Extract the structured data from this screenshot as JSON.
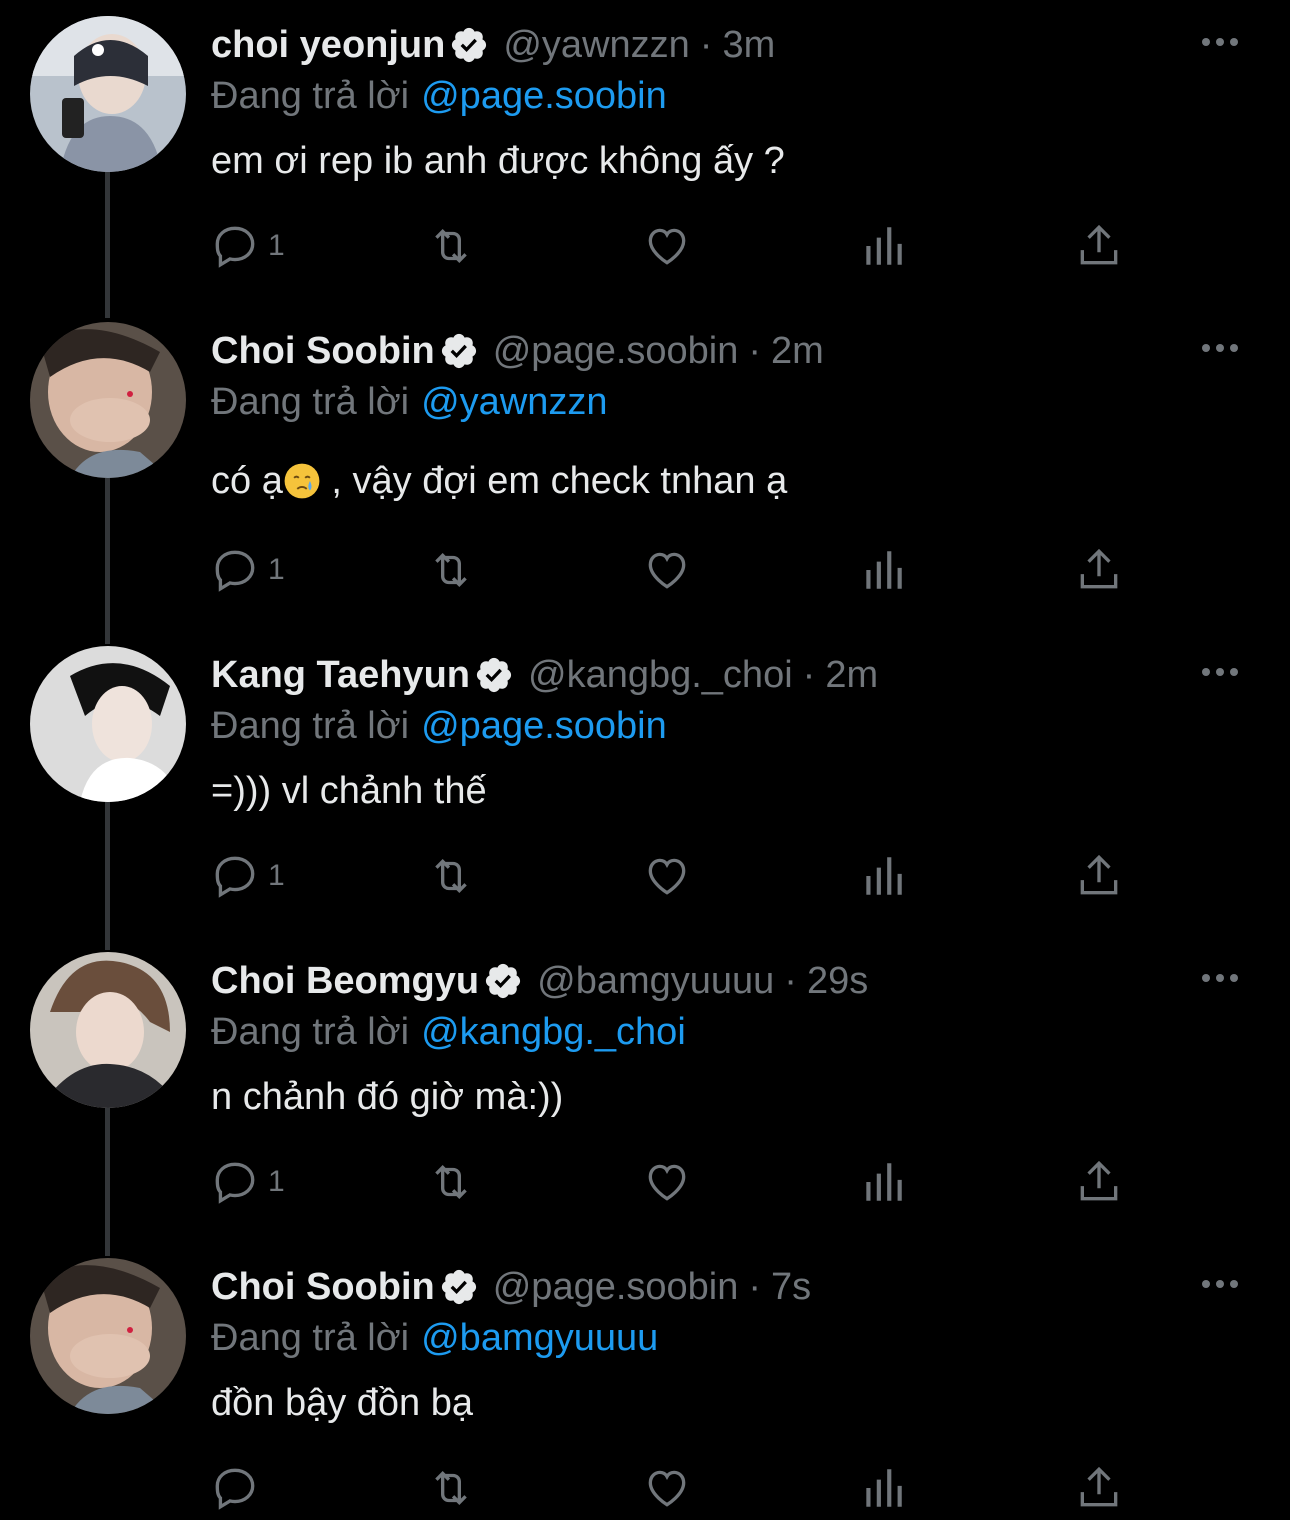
{
  "tweets": [
    {
      "name": "choi yeonjun",
      "handle": "@yawnzzn",
      "dot": "·",
      "time": "3m",
      "reply_prefix": "Đang trả lời",
      "reply_to": "@page.soobin",
      "text": "em ơi rep ib anh được không ấy ?",
      "reply_count": "1"
    },
    {
      "name": "Choi Soobin",
      "handle": "@page.soobin",
      "dot": "·",
      "time": "2m",
      "reply_prefix": "Đang trả lời",
      "reply_to": "@yawnzzn",
      "text_before": "có ạ",
      "emoji": "crying-face-emoji",
      "text_after": " , vậy đợi em check tnhan ạ",
      "reply_count": "1"
    },
    {
      "name": "Kang Taehyun",
      "handle": "@kangbg._choi",
      "dot": "·",
      "time": "2m",
      "reply_prefix": "Đang trả lời",
      "reply_to": "@page.soobin",
      "text": "=))) vl chảnh thế",
      "reply_count": "1"
    },
    {
      "name": "Choi Beomgyu",
      "handle": "@bamgyuuuu",
      "dot": "·",
      "time": "29s",
      "reply_prefix": "Đang trả lời",
      "reply_to": "@kangbg._choi",
      "text": "n chảnh đó giờ mà:))",
      "reply_count": "1"
    },
    {
      "name": "Choi Soobin",
      "handle": "@page.soobin",
      "dot": "·",
      "time": "7s",
      "reply_prefix": "Đang trả lời",
      "reply_to": "@bamgyuuuu",
      "text": "đồn bậy đồn bạ",
      "reply_count": ""
    }
  ],
  "icons": {
    "reply": "reply-icon",
    "retweet": "retweet-icon",
    "like": "heart-icon",
    "views": "views-icon",
    "share": "share-icon",
    "more": "more-icon",
    "verified": "verified-badge-icon"
  },
  "colors": {
    "background": "#000000",
    "text": "#e7e9ea",
    "secondary": "#71767b",
    "mention": "#1d9bf0",
    "thread_line": "#333639"
  }
}
